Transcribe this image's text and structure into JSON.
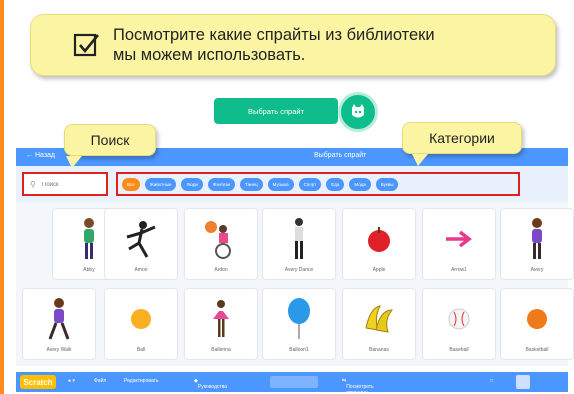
{
  "callout": {
    "line1": "Посмотрите какие спрайты из  библиотеки",
    "line2": "мы можем использовать."
  },
  "choose_sprite": {
    "label": "Выбрать спрайт"
  },
  "tags": {
    "search": "Поиск",
    "categories": "Категории"
  },
  "library_header": {
    "back_label": "Назад",
    "title": "Выбрать спрайт"
  },
  "search": {
    "placeholder": "Поиск"
  },
  "categories": [
    "Все",
    "Животные",
    "Люди",
    "Фэнтези",
    "Танец",
    "Музыка",
    "Спорт",
    "Еда",
    "Мода",
    "Буквы"
  ],
  "sprites": [
    {
      "name": "Abby",
      "icon": "girl-figure"
    },
    {
      "name": "Amon",
      "icon": "dancer-figure"
    },
    {
      "name": "Ardon",
      "icon": "wheelchair-figure"
    },
    {
      "name": "Avery Dance",
      "icon": "standing-figure"
    },
    {
      "name": "Apple",
      "icon": "apple"
    },
    {
      "name": "Arrow1",
      "icon": "arrow"
    },
    {
      "name": "Avery",
      "icon": "girl-figure"
    },
    {
      "name": "Avery Walk",
      "icon": "walking-figure"
    },
    {
      "name": "Ball",
      "icon": "ball"
    },
    {
      "name": "Ballerina",
      "icon": "ballerina-figure"
    },
    {
      "name": "Balloon1",
      "icon": "balloon"
    },
    {
      "name": "Bananas",
      "icon": "bananas"
    },
    {
      "name": "Baseball",
      "icon": "baseball"
    },
    {
      "name": "Basketball",
      "icon": "basketball"
    }
  ],
  "bottom_bar": {
    "logo": "Scratch",
    "file": "Файл",
    "edit": "Редактировать",
    "tutorials": "Руководства",
    "share": "Посмотреть страницу проекта"
  },
  "colors": {
    "accent_blue": "#4c97ff",
    "accent_green": "#0fbd8c",
    "callout_yellow": "#fbf5a3",
    "highlight_red": "#e02020"
  }
}
